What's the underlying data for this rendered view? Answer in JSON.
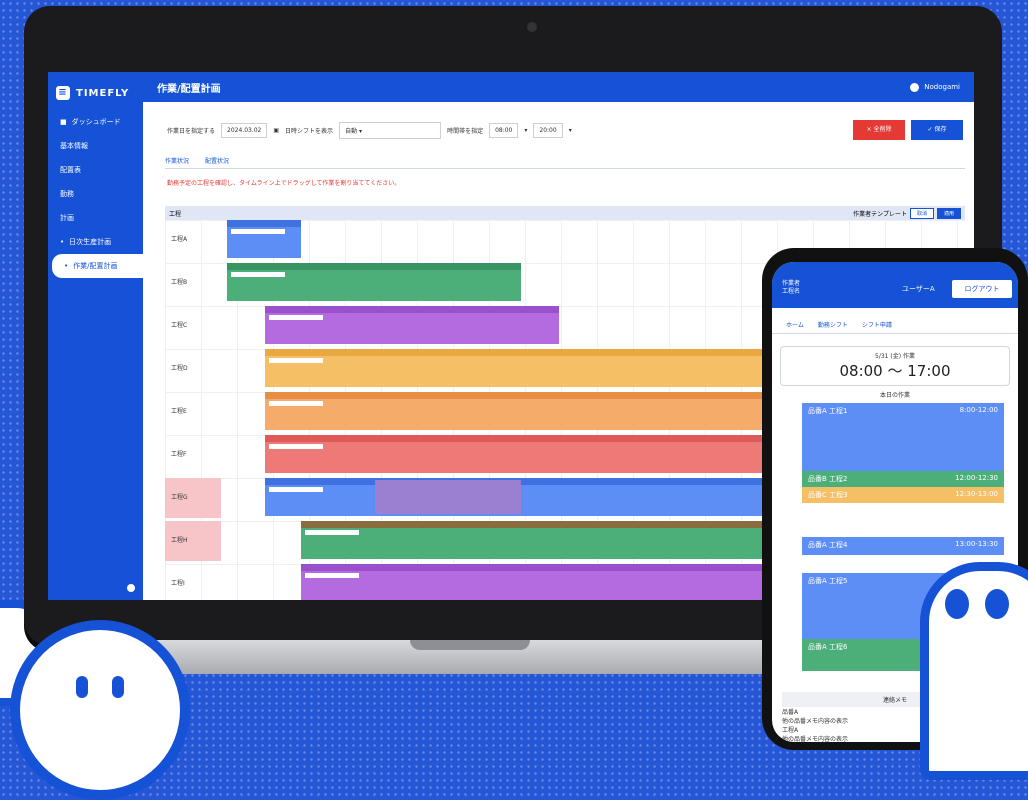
{
  "app": {
    "logo": "TIMEFLY",
    "page_title": "作業/配置計画",
    "user": "Nodogami"
  },
  "sidebar": {
    "items": [
      {
        "label": "ダッシュボード",
        "active": false
      },
      {
        "label": "基本情報",
        "active": false
      },
      {
        "label": "配置表",
        "active": false
      },
      {
        "label": "勤務",
        "active": false
      },
      {
        "label": "計画",
        "active": false
      },
      {
        "label": "日次生産計画",
        "active": false
      },
      {
        "label": "作業/配置計画",
        "active": true
      }
    ]
  },
  "filters": {
    "date_label": "作業日を指定する",
    "date_value": "2024.03.02",
    "shift_label": "日時シフトを表示",
    "shift_value": "自動",
    "time_label": "時間帯を指定",
    "time_from": "08:00",
    "time_to": "20:00"
  },
  "buttons": {
    "delete": "× 全削除",
    "save": "✓ 保存"
  },
  "tabs": [
    "作業状況",
    "配置状況"
  ],
  "notice": "勤務予定の工程を確認し、タイムライン上でドラッグして作業を割り当ててください。",
  "gantt": {
    "header_label": "工程",
    "template_label": "作業者テンプレート",
    "btn_cancel": "取消",
    "btn_apply": "適用",
    "rows": [
      "工程A",
      "工程B",
      "工程C",
      "工程D",
      "工程E",
      "工程F",
      "工程G",
      "工程H",
      "工程I"
    ],
    "colors": {
      "blue": "#5d8ef5",
      "green": "#4caf7a",
      "purple": "#b46be0",
      "orange": "#f5bf66",
      "red": "#ee7a78"
    }
  },
  "phone": {
    "header_line1": "作業者",
    "header_line2": "工程名",
    "user": "ユーザーA",
    "logout": "ログアウト",
    "tabs": [
      "ホーム",
      "勤務シフト",
      "シフト申請"
    ],
    "date": "5/31 (金) 作業",
    "time": "08:00 〜 17:00",
    "subtitle": "本日の作業",
    "blocks": [
      {
        "name": "品番A 工程1",
        "time": "8:00-12:00",
        "color": "#5d8ef5"
      },
      {
        "name": "品番B 工程2",
        "time": "12:00-12:30",
        "color": "#4caf7a"
      },
      {
        "name": "品番C 工程3",
        "time": "12:30-13:00",
        "color": "#f5bf66"
      },
      {
        "name": "品番A 工程4",
        "time": "13:00-13:30",
        "color": "#5d8ef5"
      },
      {
        "name": "品番A 工程5",
        "time": "",
        "color": "#5d8ef5"
      },
      {
        "name": "品番A 工程6",
        "time": "",
        "color": "#4caf7a"
      }
    ],
    "memo_title": "連絡メモ",
    "memo_lines": [
      "品番A",
      "他の品番メモ内容の表示",
      "工程A",
      "他の品番メモ内容の表示"
    ]
  }
}
